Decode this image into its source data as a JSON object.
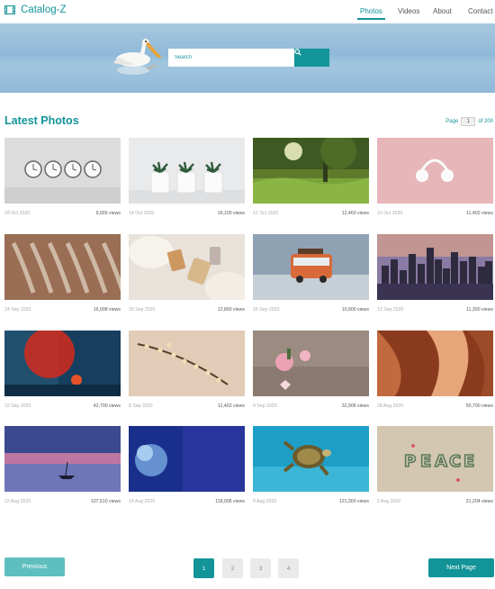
{
  "brand": {
    "name": "Catalog-Z",
    "icon": "film-icon"
  },
  "nav": {
    "items": [
      "Photos",
      "Videos",
      "About",
      "Contact"
    ],
    "active": "Photos"
  },
  "search": {
    "placeholder": "Search",
    "icon": "search-icon"
  },
  "section": {
    "title": "Latest Photos"
  },
  "pager_top": {
    "label": "Page",
    "current": "1",
    "total_label": "of 200"
  },
  "photos": [
    {
      "scene": "clocks",
      "date": "18 Oct 2020",
      "views": "9,906 views"
    },
    {
      "scene": "plants",
      "date": "14 Oct 2020",
      "views": "16,100 views"
    },
    {
      "scene": "forest",
      "date": "12 Oct 2020",
      "views": "12,460 views"
    },
    {
      "scene": "headphones",
      "date": "10 Oct 2020",
      "views": "11,402 views"
    },
    {
      "scene": "hangers",
      "date": "24 Sep 2020",
      "views": "16,008 views"
    },
    {
      "scene": "perfume",
      "date": "20 Sep 2020",
      "views": "12,860 views"
    },
    {
      "scene": "toy-bus",
      "date": "16 Sep 2020",
      "views": "10,900 views"
    },
    {
      "scene": "city",
      "date": "12 Sep 2020",
      "views": "11,300 views"
    },
    {
      "scene": "red-balloon",
      "date": "10 Sep 2020",
      "views": "42,700 views"
    },
    {
      "scene": "blossom",
      "date": "8 Sep 2020",
      "views": "11,402 views"
    },
    {
      "scene": "roses",
      "date": "4 Sep 2020",
      "views": "32,906 views"
    },
    {
      "scene": "canyon",
      "date": "28 Aug 2020",
      "views": "50,700 views"
    },
    {
      "scene": "boat-sunset",
      "date": "22 Aug 2020",
      "views": "107,510 views"
    },
    {
      "scene": "coral",
      "date": "14 Aug 2020",
      "views": "118,006 views"
    },
    {
      "scene": "turtle",
      "date": "8 Aug 2020",
      "views": "121,300 views"
    },
    {
      "scene": "peace",
      "date": "2 Aug 2020",
      "views": "21,204 views"
    }
  ],
  "pagination": {
    "prev_label": "Previous",
    "next_label": "Next Page",
    "pages": [
      "1",
      "2",
      "3",
      "4"
    ],
    "active": "1"
  },
  "colors": {
    "accent": "#139498",
    "accent_light": "#5fbfbf"
  }
}
